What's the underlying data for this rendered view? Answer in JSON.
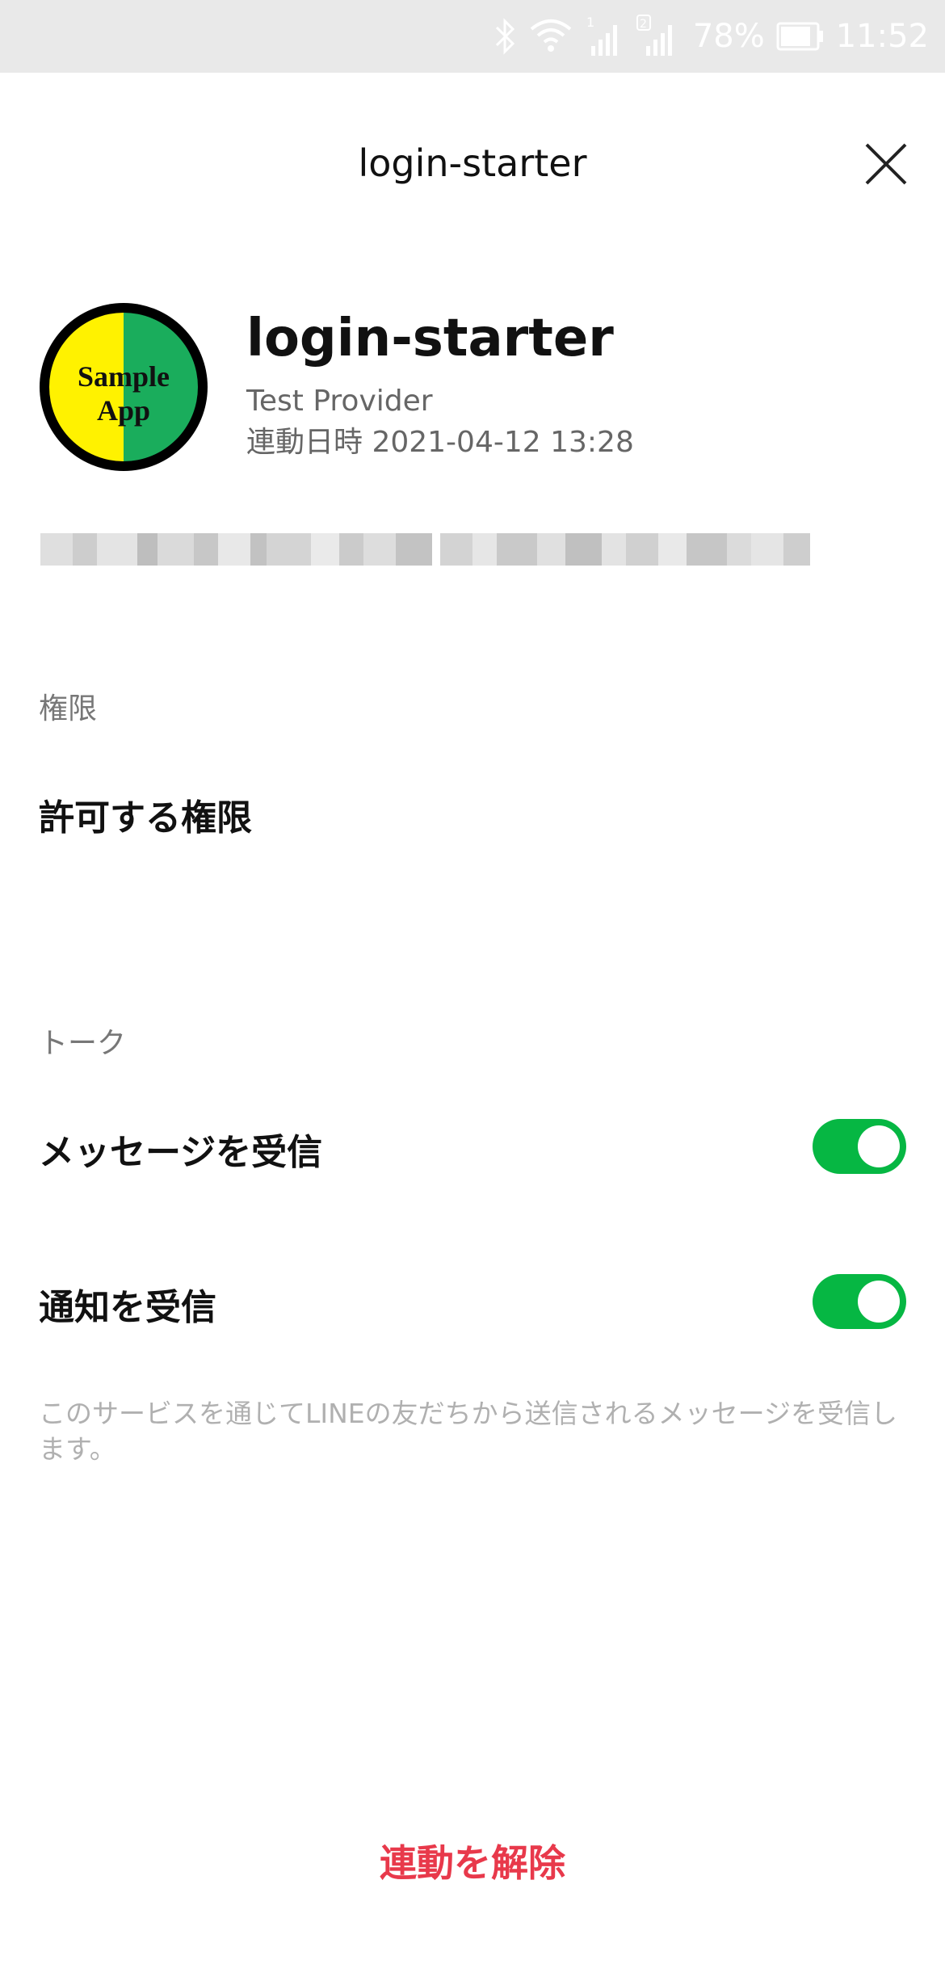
{
  "status_bar": {
    "battery": "78%",
    "time": "11:52",
    "sim1": "1",
    "sim2": "2",
    "icons": [
      "bluetooth-icon",
      "wifi-icon",
      "signal-icon",
      "battery-icon"
    ]
  },
  "header": {
    "title": "login-starter",
    "close_icon": "close-icon"
  },
  "app": {
    "logo_text_line1": "Sample",
    "logo_text_line2": "App",
    "name": "login-starter",
    "provider": "Test Provider",
    "linked_at": "連動日時 2021-04-12 13:28"
  },
  "permissions": {
    "section_label": "権限",
    "item_label": "許可する権限"
  },
  "talk": {
    "section_label": "トーク",
    "receive_messages_label": "メッセージを受信",
    "receive_messages_on": true,
    "receive_notifications_label": "通知を受信",
    "receive_notifications_on": true,
    "note": "このサービスを通じてLINEの友だちから送信されるメッセージを受信します。"
  },
  "actions": {
    "unlink_label": "連動を解除"
  },
  "colors": {
    "accent_green": "#06b743",
    "danger_red": "#e8394b",
    "logo_yellow": "#fff200",
    "logo_green": "#1aad5c"
  }
}
